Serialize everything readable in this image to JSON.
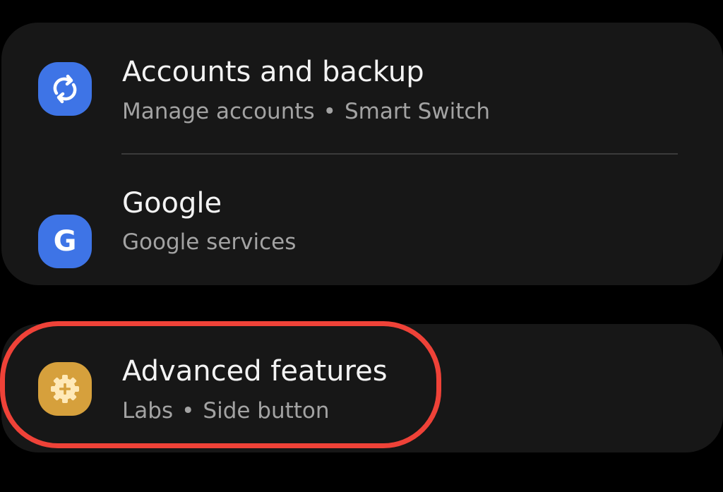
{
  "settings_list": {
    "items": [
      {
        "title": "Accounts and backup",
        "subtitle_parts": [
          "Manage accounts",
          "Smart Switch"
        ],
        "icon": "sync-icon",
        "icon_color": "#3e74e6"
      },
      {
        "title": "Google",
        "subtitle_parts": [
          "Google services"
        ],
        "icon": "google-g-icon",
        "icon_glyph": "G",
        "icon_color": "#3e74e6"
      },
      {
        "title": "Advanced features",
        "subtitle_parts": [
          "Labs",
          "Side button"
        ],
        "icon": "gear-plus-icon",
        "icon_color": "#d6a03c",
        "highlighted": true
      }
    ],
    "separator": "•"
  },
  "colors": {
    "background": "#000000",
    "card": "#171717",
    "title_text": "#f3f3f3",
    "subtitle_text": "#a3a3a3",
    "highlight": "#ef4238"
  }
}
